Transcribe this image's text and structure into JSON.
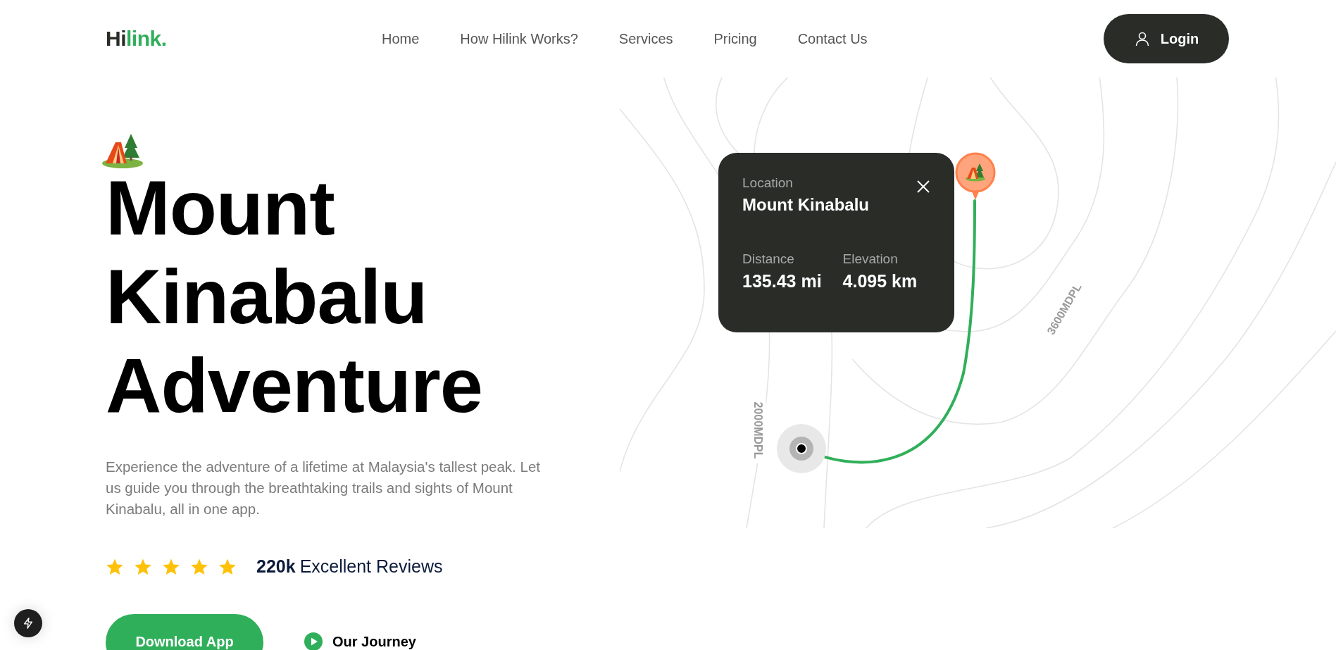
{
  "header": {
    "logo": {
      "dark": "Hi",
      "accent": "link."
    },
    "nav": [
      {
        "label": "Home"
      },
      {
        "label": "How Hilink Works?"
      },
      {
        "label": "Services"
      },
      {
        "label": "Pricing"
      },
      {
        "label": "Contact Us"
      }
    ],
    "login": "Login"
  },
  "hero": {
    "title_lines": [
      "Mount",
      "Kinabalu",
      "Adventure"
    ],
    "description": "Experience the adventure of a lifetime at Malaysia's tallest peak. Let us guide you through the breathtaking trails and sights of Mount Kinabalu, all in one app.",
    "rating": {
      "stars": 5,
      "count": "220k",
      "label": "Excellent Reviews"
    },
    "buttons": [
      {
        "kind": "primary",
        "label": "Download App"
      },
      {
        "kind": "play",
        "label": "Our Journey"
      }
    ]
  },
  "map": {
    "labels": [
      "2000MDPL",
      "3600MDPL"
    ],
    "card": {
      "caption": "Location",
      "name": "Mount Kinabalu",
      "stats": [
        {
          "label": "Distance",
          "value": "135.43 mi"
        },
        {
          "label": "Elevation",
          "value": "4.095 km"
        }
      ]
    }
  }
}
